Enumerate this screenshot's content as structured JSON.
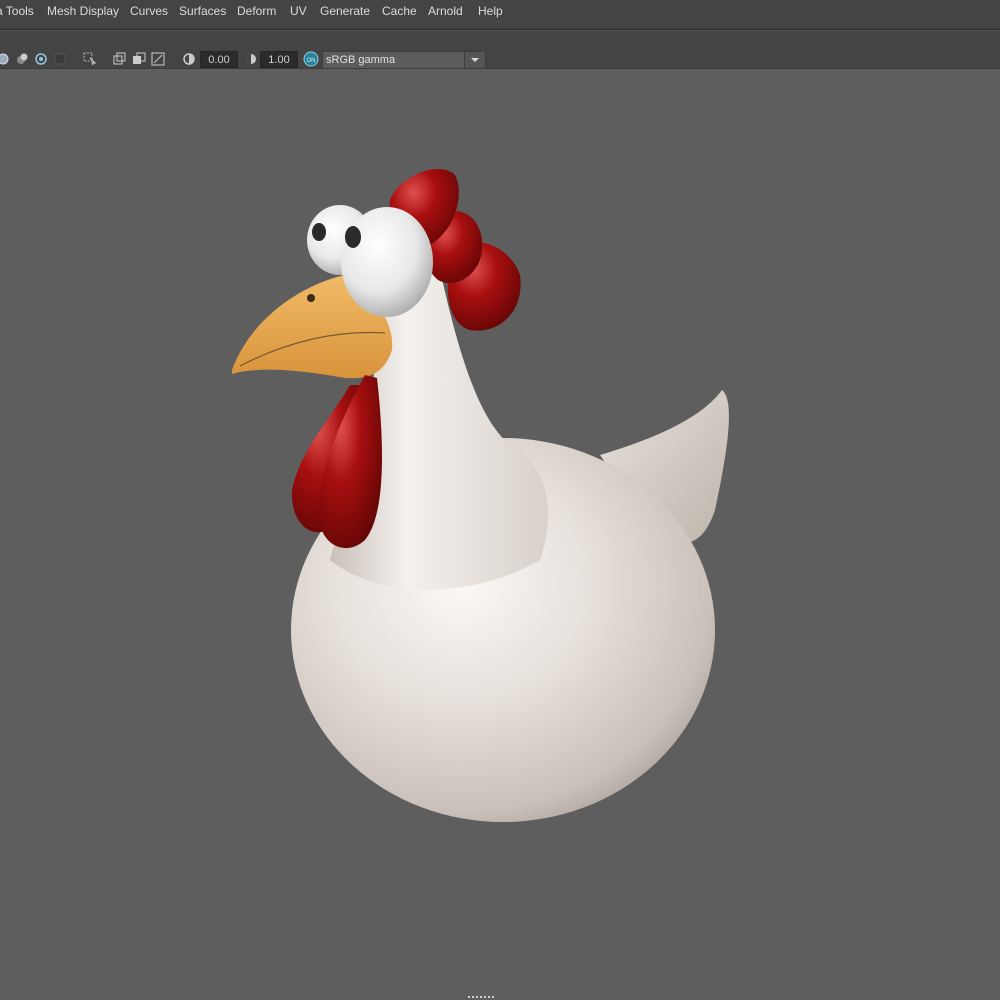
{
  "menu": {
    "items": [
      {
        "label": "a Tools"
      },
      {
        "label": "Mesh Display"
      },
      {
        "label": "Curves"
      },
      {
        "label": "Surfaces"
      },
      {
        "label": "Deform"
      },
      {
        "label": "UV"
      },
      {
        "label": "Generate"
      },
      {
        "label": "Cache"
      },
      {
        "label": "Arnold"
      },
      {
        "label": "Help"
      }
    ]
  },
  "toolbar": {
    "exposure_value": "0.00",
    "gamma_value": "1.00",
    "color_space": "sRGB gamma",
    "icons": [
      "wireframe-shade-icon",
      "shaded-icon",
      "isolate-icon",
      "xray-icon",
      "select-camera-icon",
      "grid-icon",
      "resolution-gate-icon",
      "film-gate-icon",
      "exposure-icon",
      "gamma-icon",
      "color-management-icon"
    ]
  },
  "viewport": {
    "background_color": "#5e5e5e",
    "model": "cartoon-chicken",
    "colors": {
      "body": "#e9e4df",
      "comb": "#a10f0f",
      "beak": "#e8a84f",
      "eye": "#f2f2f2",
      "pupil": "#2a2a2a"
    }
  }
}
